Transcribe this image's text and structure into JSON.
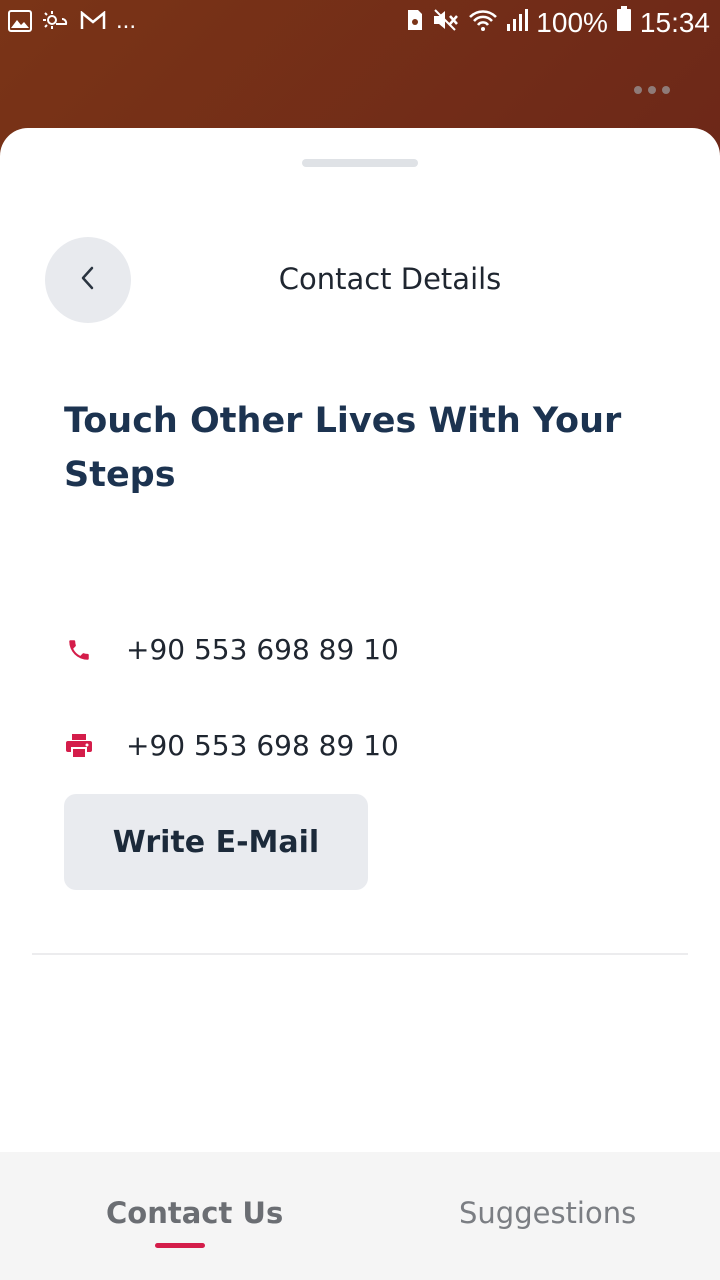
{
  "status_bar": {
    "notification_icons": [
      "gallery-icon",
      "weather-icon",
      "gmail-icon",
      "more-icon"
    ],
    "more_text": "...",
    "battery": "100%",
    "time": "15:34"
  },
  "sheet": {
    "header_title": "Contact Details",
    "headline": "Touch Other Lives With Your Steps",
    "phone": {
      "icon": "phone-icon",
      "number": "+90 553 698 89 10"
    },
    "fax": {
      "icon": "fax-icon",
      "number": "+90 553 698 89 10"
    },
    "email_button_label": "Write E-Mail"
  },
  "tabs": [
    {
      "label": "Contact Us",
      "active": true
    },
    {
      "label": "Suggestions",
      "active": false
    }
  ],
  "colors": {
    "accent": "#d41d4a",
    "headline": "#1c3350",
    "header_bg": "#6b2618"
  }
}
